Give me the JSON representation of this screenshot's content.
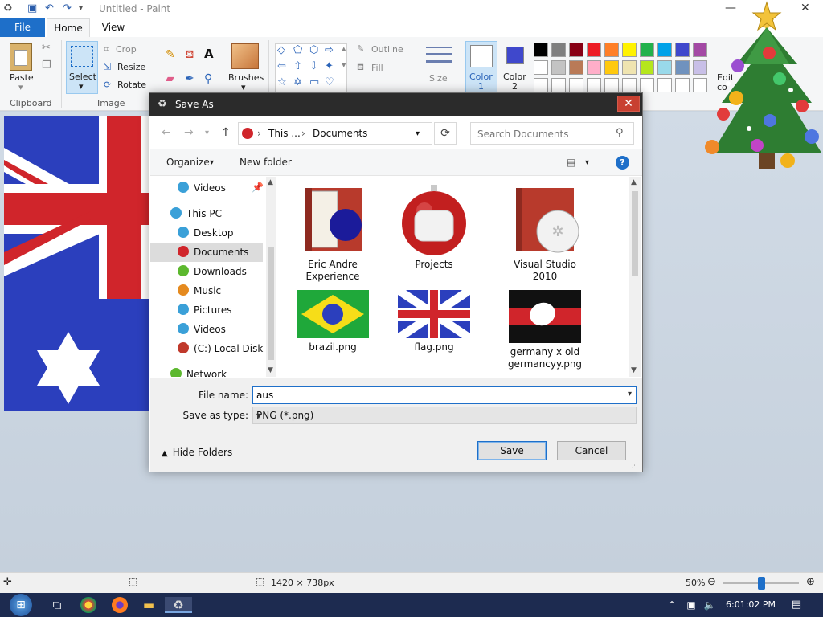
{
  "window": {
    "title": "Untitled - Paint",
    "controls": {
      "minimize": "—",
      "maximize": "☐",
      "close": "✕"
    }
  },
  "tabs": [
    {
      "label": "File"
    },
    {
      "label": "Home"
    },
    {
      "label": "View"
    }
  ],
  "ribbon": {
    "clipboard": {
      "paste": "Paste",
      "label": "Clipboard"
    },
    "image": {
      "select": "Select",
      "crop": "Crop",
      "resize": "Resize",
      "rotate": "Rotate",
      "label": "Image"
    },
    "tools": {
      "brushes": "Brushes"
    },
    "shapes": {
      "outline": "Outline",
      "fill": "Fill"
    },
    "size": "Size",
    "color1": {
      "line1": "Color",
      "line2": "1"
    },
    "color2": {
      "line1": "Color",
      "line2": "2"
    },
    "edit_colors": {
      "line1": "Edit",
      "line2": "co"
    },
    "palette_row1": [
      "#000000",
      "#7f7f7f",
      "#880015",
      "#ed1c24",
      "#ff7f27",
      "#fff200",
      "#22b14c",
      "#00a2e8",
      "#3f48cc",
      "#a349a4"
    ],
    "palette_row2": [
      "#ffffff",
      "#c3c3c3",
      "#b97a57",
      "#ffaec9",
      "#ffc90e",
      "#efe4b0",
      "#b5e61d",
      "#99d9ea",
      "#7092be",
      "#c8bfe7"
    ],
    "palette_row3": [
      "#ffffff",
      "#ffffff",
      "#ffffff",
      "#ffffff",
      "#ffffff",
      "#ffffff",
      "#ffffff",
      "#ffffff",
      "#ffffff",
      "#ffffff"
    ]
  },
  "dialog": {
    "title": "Save As",
    "close": "✕",
    "breadcrumb": [
      "This ...",
      "Documents"
    ],
    "search_placeholder": "Search Documents",
    "organize": "Organize",
    "new_folder": "New folder",
    "help": "?",
    "nav_items": [
      {
        "label": "Videos",
        "color": "#3aa0d8"
      },
      {
        "label": "This PC",
        "color": "#3aa0d8"
      },
      {
        "label": "Desktop",
        "color": "#3aa0d8"
      },
      {
        "label": "Documents",
        "color": "#d0252b"
      },
      {
        "label": "Downloads",
        "color": "#5cb82e"
      },
      {
        "label": "Music",
        "color": "#e58a1f"
      },
      {
        "label": "Pictures",
        "color": "#3aa0d8"
      },
      {
        "label": "Videos",
        "color": "#3aa0d8"
      },
      {
        "label": "(C:) Local Disk",
        "color": "#c0392b"
      },
      {
        "label": "Network",
        "color": "#5cb82e"
      }
    ],
    "files": [
      {
        "line1": "Eric Andre",
        "line2": "Experience"
      },
      {
        "line1": "Projects",
        "line2": ""
      },
      {
        "line1": "Visual Studio",
        "line2": "2010"
      },
      {
        "line1": "brazil.png",
        "line2": ""
      },
      {
        "line1": "flag.png",
        "line2": ""
      },
      {
        "line1": "germany x old",
        "line2": "germancyy.png"
      }
    ],
    "file_name_label": "File name:",
    "file_name_value": "aus",
    "save_type_label": "Save as type:",
    "save_type_value": "PNG (*.png)",
    "hide_folders": "Hide Folders",
    "save": "Save",
    "cancel": "Cancel"
  },
  "status": {
    "dimensions": "1420 × 738px",
    "zoom": "50%",
    "zoom_level": 0.5
  },
  "taskbar": {
    "time": "6:01:02 PM"
  }
}
